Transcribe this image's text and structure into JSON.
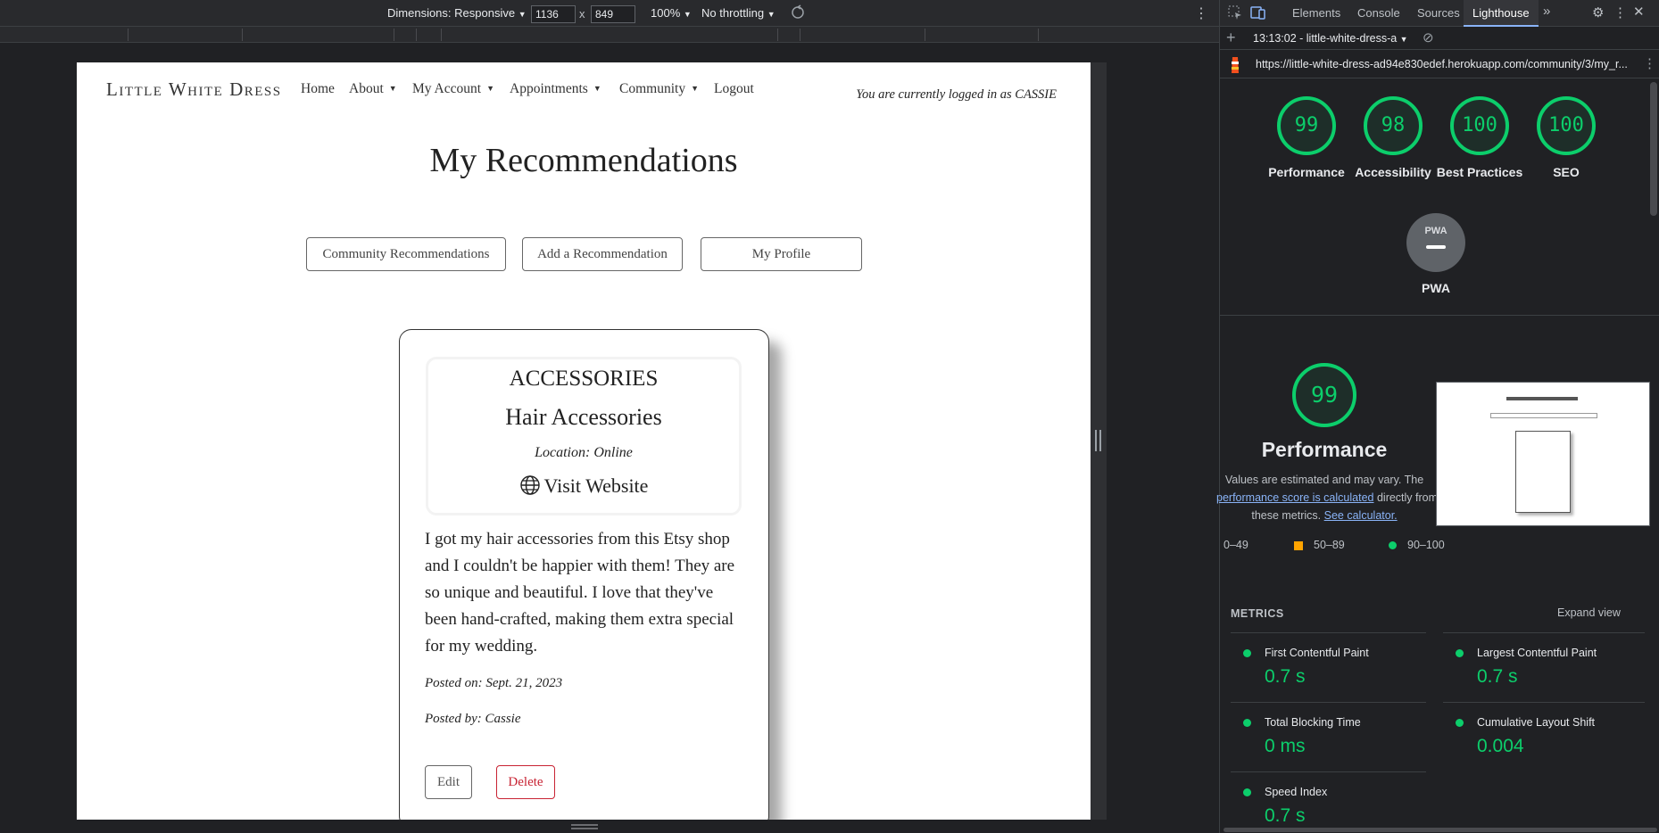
{
  "toolbar": {
    "dimensions": "Dimensions: Responsive",
    "width": "1136",
    "height": "849",
    "times": "x",
    "zoom": "100%",
    "throttling": "No throttling"
  },
  "site": {
    "brand": "Little White Dress",
    "nav": {
      "home": "Home",
      "about": "About",
      "account": "My Account",
      "appointments": "Appointments",
      "community": "Community",
      "logout": "Logout"
    },
    "logged_in": "You are currently logged in as CASSIE",
    "page_title": "My Recommendations",
    "buttons": {
      "community": "Community Recommendations",
      "add": "Add a Recommendation",
      "profile": "My Profile"
    },
    "card": {
      "category": "ACCESSORIES",
      "title": "Hair Accessories",
      "location": "Location: Online",
      "visit": "Visit Website",
      "review": "I got my hair accessories from this Etsy shop and I couldn't be happier with them! They are so unique and beautiful. I love that they've been hand-crafted, making them extra special for my wedding.",
      "posted_on": "Posted on: Sept. 21, 2023",
      "posted_by": "Posted by: Cassie",
      "edit": "Edit",
      "delete": "Delete"
    }
  },
  "devtools": {
    "tabs": {
      "elements": "Elements",
      "console": "Console",
      "sources": "Sources",
      "lighthouse": "Lighthouse"
    },
    "report_time": "13:13:02 - little-white-dress-a",
    "url": "https://little-white-dress-ad94e830edef.herokuapp.com/community/3/my_r...",
    "scores": {
      "performance": {
        "value": "99",
        "label": "Performance"
      },
      "accessibility": {
        "value": "98",
        "label": "Accessibility"
      },
      "best_practices": {
        "value": "100",
        "label": "Best Practices"
      },
      "seo": {
        "value": "100",
        "label": "SEO"
      }
    },
    "pwa": {
      "badge": "PWA",
      "label": "PWA"
    },
    "perf": {
      "score": "99",
      "title": "Performance",
      "desc1": "Values are estimated and may vary. The",
      "link1": "performance score is calculated",
      "desc2": "directly from",
      "desc3": "these metrics.",
      "link2": "See calculator."
    },
    "legend": {
      "low": "0–49",
      "mid": "50–89",
      "high": "90–100"
    },
    "metrics_title": "METRICS",
    "expand": "Expand view",
    "metrics": {
      "fcp": {
        "name": "First Contentful Paint",
        "value": "0.7 s"
      },
      "lcp": {
        "name": "Largest Contentful Paint",
        "value": "0.7 s"
      },
      "tbt": {
        "name": "Total Blocking Time",
        "value": "0 ms"
      },
      "cls": {
        "name": "Cumulative Layout Shift",
        "value": "0.004"
      },
      "si": {
        "name": "Speed Index",
        "value": "0.7 s"
      }
    }
  }
}
